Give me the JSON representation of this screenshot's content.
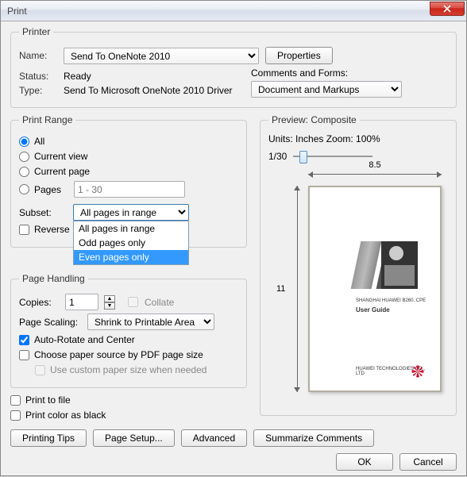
{
  "window": {
    "title": "Print"
  },
  "printer": {
    "legend": "Printer",
    "name_label": "Name:",
    "name_value": "Send To OneNote 2010",
    "properties_button": "Properties",
    "status_label": "Status:",
    "status_value": "Ready",
    "type_label": "Type:",
    "type_value": "Send To Microsoft OneNote 2010 Driver",
    "comments_label": "Comments and Forms:",
    "comments_value": "Document and Markups"
  },
  "print_range": {
    "legend": "Print Range",
    "all": "All",
    "current_view": "Current view",
    "current_page": "Current page",
    "pages": "Pages",
    "pages_placeholder": "1 - 30",
    "subset_label": "Subset:",
    "subset_value": "All pages in range",
    "subset_options": [
      "All pages in range",
      "Odd pages only",
      "Even pages only"
    ],
    "reverse": "Reverse"
  },
  "page_handling": {
    "legend": "Page Handling",
    "copies_label": "Copies:",
    "copies_value": "1",
    "collate": "Collate",
    "scaling_label": "Page Scaling:",
    "scaling_value": "Shrink to Printable Area",
    "auto_rotate": "Auto-Rotate and Center",
    "choose_paper": "Choose paper source by PDF page size",
    "use_custom": "Use custom paper size when needed"
  },
  "misc": {
    "print_to_file": "Print to file",
    "print_color_black": "Print color as black"
  },
  "preview": {
    "legend": "Preview: Composite",
    "units": "Units: Inches Zoom: 100%",
    "page_count": "1/30",
    "width": "8.5",
    "height": "11",
    "doc_title": "SHANGHAI HUAWEI B260, CPE",
    "doc_sub": "User Guide",
    "footer": "HUAWEI TECHNOLOGIES CO., LTD"
  },
  "buttons": {
    "printing_tips": "Printing Tips",
    "page_setup": "Page Setup...",
    "advanced": "Advanced",
    "summarize": "Summarize Comments",
    "ok": "OK",
    "cancel": "Cancel"
  }
}
